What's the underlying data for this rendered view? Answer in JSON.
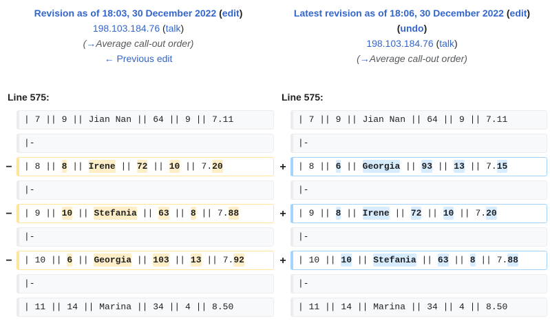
{
  "left_header": {
    "title": "Revision as of 18:03, 30 December 2022",
    "edit_label": "edit",
    "user": "198.103.184.76",
    "talk_label": "talk",
    "summary_arrow": "→",
    "summary": "Average call-out order",
    "nav_link": "← Previous edit"
  },
  "right_header": {
    "title": "Latest revision as of 18:06, 30 December 2022",
    "edit_label": "edit",
    "undo_label": "undo",
    "user": "198.103.184.76",
    "talk_label": "talk",
    "summary_arrow": "→",
    "summary": "Average call-out order"
  },
  "line_label_left": "Line 575:",
  "line_label_right": "Line 575:",
  "markers": {
    "deleted": "−",
    "added": "+"
  },
  "diff_rows": [
    {
      "type": "context",
      "left": [
        {
          "t": "| 7 || 9 || Jian Nan || 64 || 9 || 7.11"
        }
      ],
      "right": [
        {
          "t": "| 7 || 9 || Jian Nan || 64 || 9 || 7.11"
        }
      ]
    },
    {
      "type": "context",
      "left": [
        {
          "t": "|-"
        }
      ],
      "right": [
        {
          "t": "|-"
        }
      ]
    },
    {
      "type": "change",
      "left": [
        {
          "t": "| 8 || "
        },
        {
          "t": "8",
          "h": 1
        },
        {
          "t": " || "
        },
        {
          "t": "Irene",
          "h": 1
        },
        {
          "t": " || "
        },
        {
          "t": "72",
          "h": 1
        },
        {
          "t": " || "
        },
        {
          "t": "10",
          "h": 1
        },
        {
          "t": " || 7."
        },
        {
          "t": "20",
          "h": 1
        }
      ],
      "right": [
        {
          "t": "| 8 || "
        },
        {
          "t": "6",
          "h": 1
        },
        {
          "t": " || "
        },
        {
          "t": "Georgia",
          "h": 1
        },
        {
          "t": " || "
        },
        {
          "t": "93",
          "h": 1
        },
        {
          "t": " || "
        },
        {
          "t": "13",
          "h": 1
        },
        {
          "t": " || 7."
        },
        {
          "t": "15",
          "h": 1
        }
      ]
    },
    {
      "type": "context",
      "left": [
        {
          "t": "|-"
        }
      ],
      "right": [
        {
          "t": "|-"
        }
      ]
    },
    {
      "type": "change",
      "left": [
        {
          "t": "| 9 || "
        },
        {
          "t": "10",
          "h": 1
        },
        {
          "t": " || "
        },
        {
          "t": "Stefania",
          "h": 1
        },
        {
          "t": " || "
        },
        {
          "t": "63",
          "h": 1
        },
        {
          "t": " || "
        },
        {
          "t": "8",
          "h": 1
        },
        {
          "t": " || 7."
        },
        {
          "t": "88",
          "h": 1
        }
      ],
      "right": [
        {
          "t": "| 9 || "
        },
        {
          "t": "8",
          "h": 1
        },
        {
          "t": " || "
        },
        {
          "t": "Irene",
          "h": 1
        },
        {
          "t": " || "
        },
        {
          "t": "72",
          "h": 1
        },
        {
          "t": " || "
        },
        {
          "t": "10",
          "h": 1
        },
        {
          "t": " || 7."
        },
        {
          "t": "20",
          "h": 1
        }
      ]
    },
    {
      "type": "context",
      "left": [
        {
          "t": "|-"
        }
      ],
      "right": [
        {
          "t": "|-"
        }
      ]
    },
    {
      "type": "change",
      "left": [
        {
          "t": "| 10 || "
        },
        {
          "t": "6",
          "h": 1
        },
        {
          "t": " || "
        },
        {
          "t": "Georgia",
          "h": 1
        },
        {
          "t": " || "
        },
        {
          "t": "103",
          "h": 1
        },
        {
          "t": " || "
        },
        {
          "t": "13",
          "h": 1
        },
        {
          "t": " || 7."
        },
        {
          "t": "92",
          "h": 1
        }
      ],
      "right": [
        {
          "t": "| 10 || "
        },
        {
          "t": "10",
          "h": 1
        },
        {
          "t": " || "
        },
        {
          "t": "Stefania",
          "h": 1
        },
        {
          "t": " || "
        },
        {
          "t": "63",
          "h": 1
        },
        {
          "t": " || "
        },
        {
          "t": "8",
          "h": 1
        },
        {
          "t": " || 7."
        },
        {
          "t": "88",
          "h": 1
        }
      ]
    },
    {
      "type": "context",
      "left": [
        {
          "t": "|-"
        }
      ],
      "right": [
        {
          "t": "|-"
        }
      ]
    },
    {
      "type": "context",
      "left": [
        {
          "t": "| 11 || 14 || Marina || 34 || 4 || 8.50"
        }
      ],
      "right": [
        {
          "t": "| 11 || 14 || Marina || 34 || 4 || 8.50"
        }
      ]
    }
  ],
  "colors": {
    "link": "#3366cc",
    "deleted_border": "#ffe49c",
    "deleted_highlight": "#feeec8",
    "added_border": "#a3d3ff",
    "added_highlight": "#d8ecff",
    "context_background": "#f8f9fa"
  }
}
